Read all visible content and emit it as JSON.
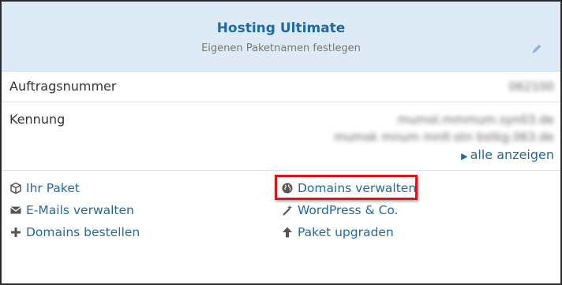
{
  "header": {
    "title": "Hosting Ultimate",
    "subtitle": "Eigenen Paketnamen festlegen"
  },
  "details": {
    "order_label": "Auftragsnummer",
    "order_value": "062100",
    "login_label": "Kennung",
    "login_values": [
      "mumol.mmmum.syn03.de",
      "mumsk mnum mnlt-stn bstkg.063.de"
    ],
    "show_all": "alle anzeigen"
  },
  "actions": {
    "left": [
      "Ihr Paket",
      "E-Mails verwalten",
      "Domains bestellen"
    ],
    "right": [
      "Domains verwalten",
      "WordPress & Co.",
      "Paket upgraden"
    ]
  },
  "colors": {
    "header_bg": "#deeaf6",
    "link": "#1f6aa5",
    "highlight": "#d9141b"
  }
}
